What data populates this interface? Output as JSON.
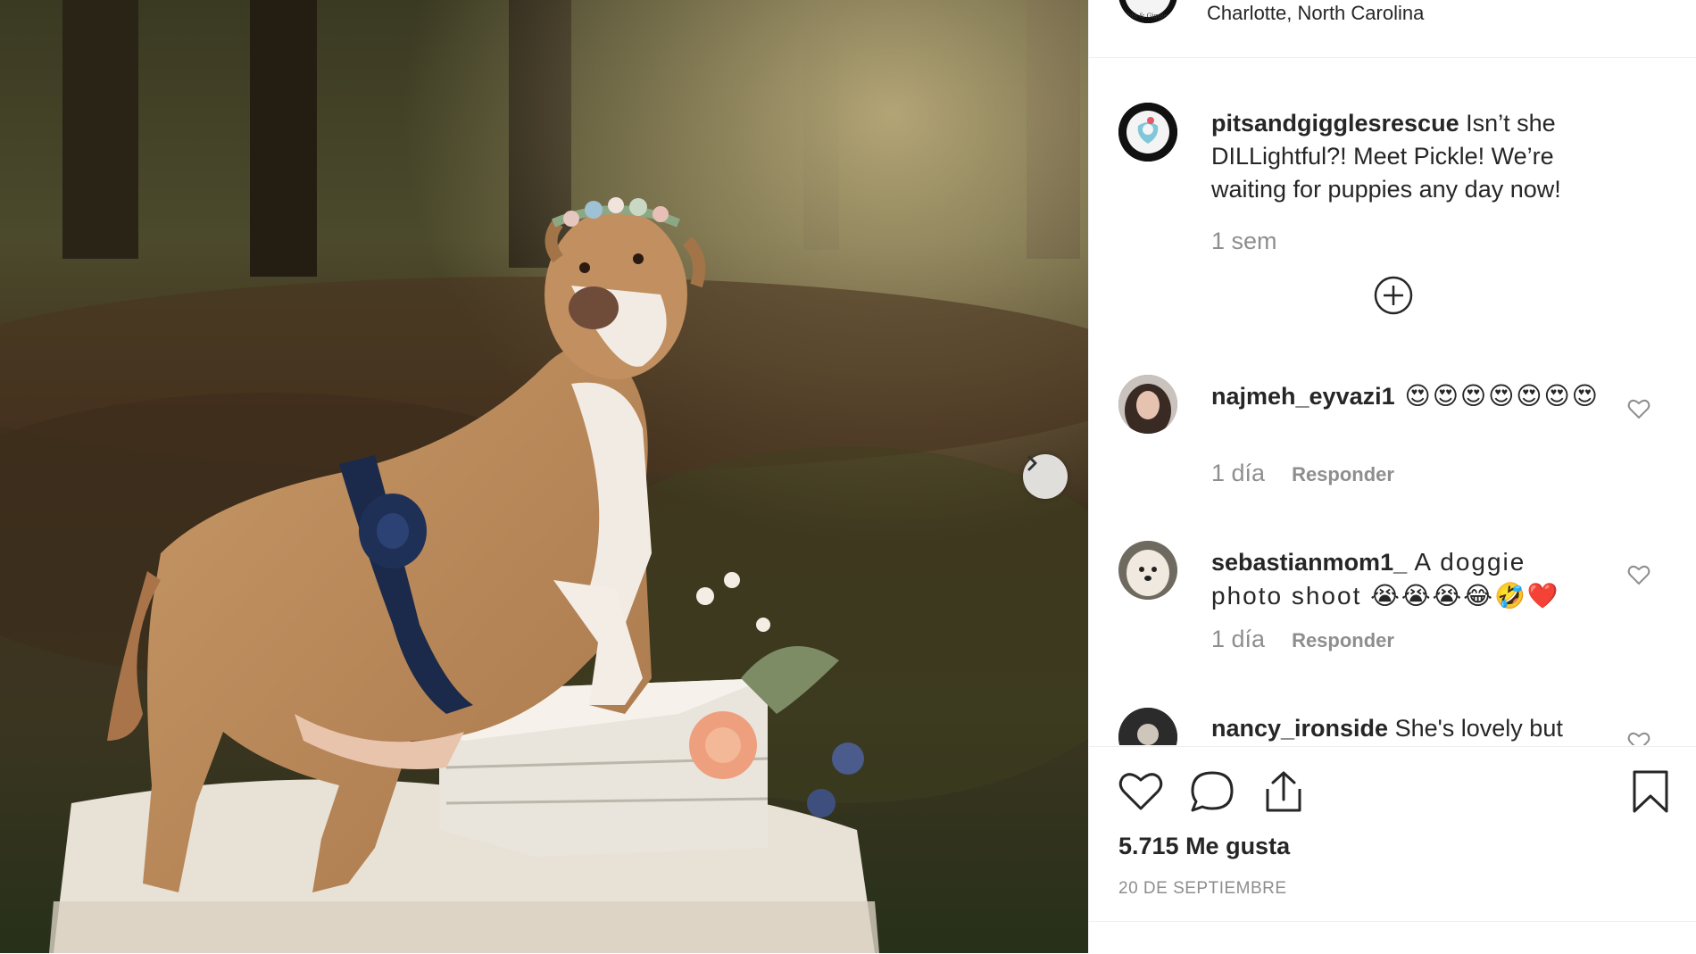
{
  "post": {
    "location": "Charlotte, North Carolina",
    "caption": {
      "user": "pitsandgigglesrescue",
      "text": " Isn’t she DILLightful?! Meet Pickle! We’re waiting for puppies any day now!",
      "time": "1 sem"
    },
    "comments": [
      {
        "user": "najmeh_eyvazi1",
        "text": " 😍😍😍😍😍😍😍",
        "time": "1 día",
        "reply_label": "Responder"
      },
      {
        "user": "sebastianmom1_",
        "text": " A doggie photo shoot 😭😭😭😂🤣❤️",
        "time": "1 día",
        "reply_label": "Responder"
      },
      {
        "user": "nancy_ironside",
        "text": " She's lovely but"
      }
    ],
    "likes": "5.715 Me gusta",
    "date": "20 DE SEPTIEMBRE"
  },
  "icons": {
    "next": "chevron-right-icon",
    "load_more": "plus-circle-icon",
    "like": "heart-outline-icon",
    "comment": "comment-bubble-icon",
    "share": "share-upload-icon",
    "save": "bookmark-icon"
  },
  "colors": {
    "text": "#262626",
    "muted": "#8e8e8e",
    "divider": "#efefef",
    "heart_red": "#ed4956"
  }
}
